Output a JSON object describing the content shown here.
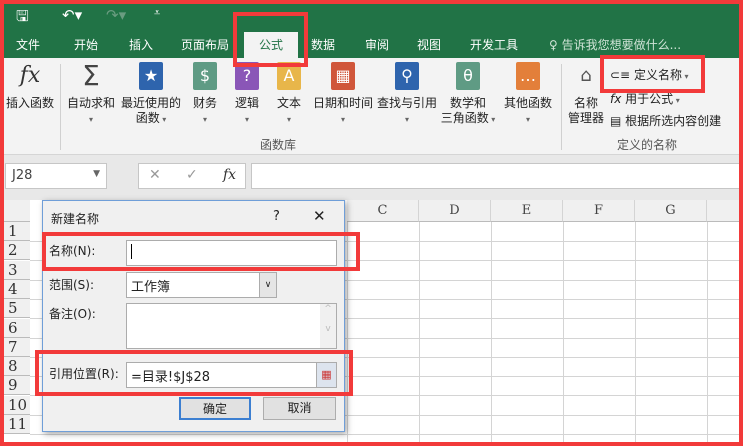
{
  "tabs": [
    "文件",
    "开始",
    "插入",
    "页面布局",
    "公式",
    "数据",
    "审阅",
    "视图",
    "开发工具"
  ],
  "active_tab": "公式",
  "tell_me": "告诉我您想要做什么...",
  "ribbon": {
    "insert_function": "插入函数",
    "autosum": "自动求和",
    "recent": [
      "最近使用的",
      "函数"
    ],
    "financial": "财务",
    "logical": "逻辑",
    "text": "文本",
    "datetime": "日期和时间",
    "lookup": "查找与引用",
    "math": [
      "数学和",
      "三角函数"
    ],
    "more": "其他函数",
    "group_library": "函数库",
    "name_manager": [
      "名称",
      "管理器"
    ],
    "define_name": "定义名称",
    "use_in_formula": "用于公式",
    "create_from_selection": "根据所选内容创建",
    "group_defined": "定义的名称"
  },
  "namebox": "J28",
  "fx": "fx",
  "columns": [
    "C",
    "D",
    "E",
    "F",
    "G"
  ],
  "rows": [
    "1",
    "2",
    "3",
    "4",
    "5",
    "6",
    "7",
    "8",
    "9",
    "10",
    "11"
  ],
  "dialog": {
    "title": "新建名称",
    "help": "?",
    "close": "✕",
    "name_label": "名称(N):",
    "name_value": "",
    "scope_label": "范围(S):",
    "scope_value": "工作簿",
    "comment_label": "备注(O):",
    "ref_label": "引用位置(R):",
    "ref_value": "=目录!$J$28",
    "ok": "确定",
    "cancel": "取消"
  },
  "colors": {
    "brand": "#217346",
    "highlight": "#f23a3a"
  }
}
